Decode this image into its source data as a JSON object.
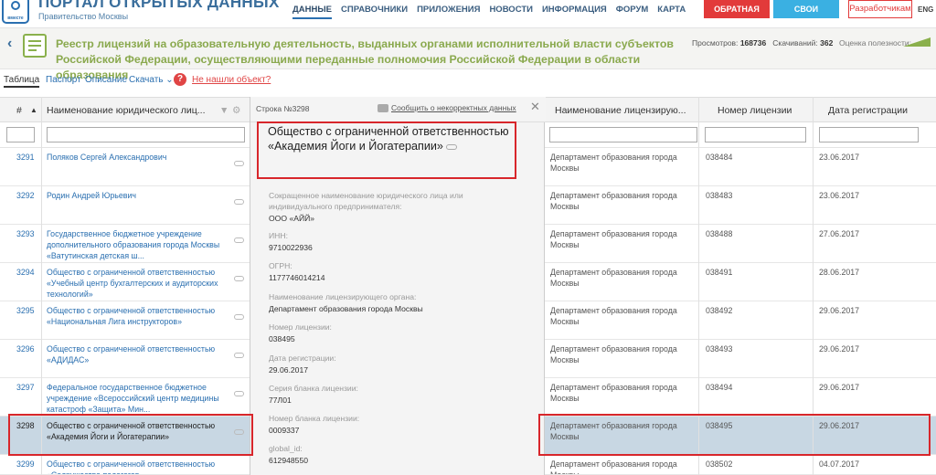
{
  "header": {
    "logo_text": "вместе",
    "portal_title": "ПОРТАЛ ОТКРЫТЫХ ДАННЫХ",
    "portal_subtitle": "Правительство Москвы",
    "nav": [
      "ДАННЫЕ",
      "СПРАВОЧНИКИ",
      "ПРИЛОЖЕНИЯ",
      "НОВОСТИ",
      "ИНФОРМАЦИЯ",
      "ФОРУМ",
      "КАРТА"
    ],
    "feedback_label": "ОБРАТНАЯ СВЯЗЬ",
    "products_label": "СВОИ ПРОДУКТЫ!",
    "developers_label": "Разработчикам",
    "lang": "ENG"
  },
  "dataset": {
    "title": "Реестр лицензий на образовательную деятельность, выданных органами исполнительной власти субъектов Российской Федерации, осуществляющими переданные полномочия Российской Федерации в области образования",
    "views_label": "Просмотров:",
    "views": "168736",
    "downloads_label": "Скачиваний:",
    "downloads": "362",
    "rating_label": "Оценка полезности:"
  },
  "tabs": {
    "table": "Таблица",
    "passport": "Паспорт",
    "description": "Описание",
    "download": "Скачать",
    "help": "?",
    "not_found": "Не нашли объект?"
  },
  "columns": {
    "num": "#",
    "name": "Наименование юридического лиц...",
    "org": "Наименование лицензирую...",
    "license": "Номер лицензии",
    "date": "Дата регистрации"
  },
  "rows": [
    {
      "num": "3291",
      "name": "Поляков Сергей Александрович",
      "org": "Департамент образования города Москвы",
      "license": "038484",
      "date": "23.06.2017"
    },
    {
      "num": "3292",
      "name": "Родин Андрей Юрьевич",
      "org": "Департамент образования города Москвы",
      "license": "038483",
      "date": "23.06.2017"
    },
    {
      "num": "3293",
      "name": "Государственное бюджетное учреждение дополнительного образования города Москвы «Ватутинская детская ш...",
      "org": "Департамент образования города Москвы",
      "license": "038488",
      "date": "27.06.2017"
    },
    {
      "num": "3294",
      "name": "Общество с ограниченной ответственностью «Учебный центр бухгалтерских и аудиторских технологий»",
      "org": "Департамент образования города Москвы",
      "license": "038491",
      "date": "28.06.2017"
    },
    {
      "num": "3295",
      "name": "Общество с ограниченной ответственностью «Национальная Лига инструкторов»",
      "org": "Департамент образования города Москвы",
      "license": "038492",
      "date": "29.06.2017"
    },
    {
      "num": "3296",
      "name": "Общество с ограниченной ответственностью «АДИДАС»",
      "org": "Департамент образования города Москвы",
      "license": "038493",
      "date": "29.06.2017"
    },
    {
      "num": "3297",
      "name": "Федеральное государственное бюджетное учреждение «Всероссийский центр медицины катастроф «Защита» Мин...",
      "org": "Департамент образования города Москвы",
      "license": "038494",
      "date": "29.06.2017"
    },
    {
      "num": "3298",
      "name": "Общество с ограниченной ответственностью «Академия Йоги и Йогатерапии»",
      "org": "Департамент образования города Москвы",
      "license": "038495",
      "date": "29.06.2017"
    },
    {
      "num": "3299",
      "name": "Общество с ограниченной ответственностью «Содружество педагогов...",
      "org": "Департамент образования города Москвы",
      "license": "038502",
      "date": "04.07.2017"
    }
  ],
  "panel": {
    "row_label": "Строка №3298",
    "report_label": "Сообщить о некорректных данных",
    "close": "✕",
    "title": "Общество с ограниченной ответственностью «Академия Йоги и Йогатерапии»",
    "fields": [
      {
        "label": "Сокращенное наименование юридического лица или индивидуального предпринимателя:",
        "value": "ООО «АЙЙ»"
      },
      {
        "label": "ИНН:",
        "value": "9710022936"
      },
      {
        "label": "ОГРН:",
        "value": "1177746014214"
      },
      {
        "label": "Наименование лицензирующего органа:",
        "value": "Департамент образования города Москвы"
      },
      {
        "label": "Номер лицензии:",
        "value": "038495"
      },
      {
        "label": "Дата регистрации:",
        "value": "29.06.2017"
      },
      {
        "label": "Серия бланка лицензии:",
        "value": "77Л01"
      },
      {
        "label": "Номер бланка лицензии:",
        "value": "0009337"
      },
      {
        "label": "global_id:",
        "value": "612948550"
      }
    ]
  },
  "colors": {
    "accent": "#2a6fb0",
    "highlight": "#d8262b",
    "selected_row": "#c8d7e3",
    "title_green": "#8aa94e"
  }
}
